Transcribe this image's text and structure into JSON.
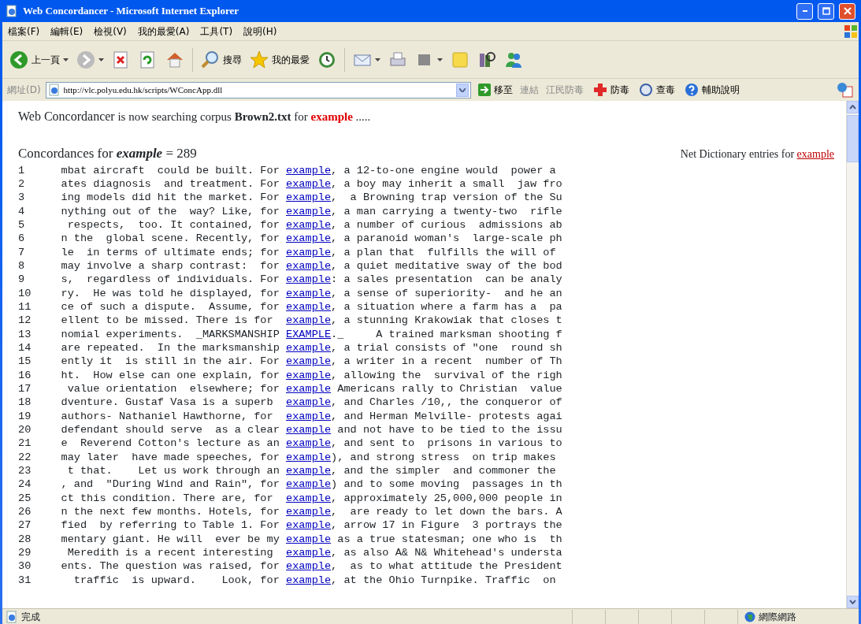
{
  "window": {
    "title": "Web Concordancer - Microsoft Internet Explorer"
  },
  "menu": [
    "檔案(F)",
    "編輯(E)",
    "檢視(V)",
    "我的最愛(A)",
    "工具(T)",
    "說明(H)"
  ],
  "toolbar": [
    {
      "kind": "back",
      "label": "上一頁"
    },
    {
      "kind": "forward"
    },
    {
      "kind": "stop"
    },
    {
      "kind": "refresh"
    },
    {
      "kind": "home"
    },
    {
      "kind": "search",
      "label": "搜尋"
    },
    {
      "kind": "favorites",
      "label": "我的最愛"
    },
    {
      "kind": "history"
    },
    {
      "kind": "mail"
    },
    {
      "kind": "print"
    },
    {
      "kind": "edit"
    },
    {
      "kind": "note"
    },
    {
      "kind": "research"
    },
    {
      "kind": "messenger"
    }
  ],
  "address": {
    "label": "網址(D)",
    "value": "http://vlc.polyu.edu.hk/scripts/WConcApp.dll",
    "go": "移至",
    "links_label": "連結",
    "links": [
      {
        "kind": "text",
        "label": "江民防毒"
      },
      {
        "kind": "cross",
        "label": "防毒"
      },
      {
        "kind": "scan",
        "label": "查毒"
      },
      {
        "kind": "help",
        "label": "輔助說明"
      }
    ]
  },
  "status_message": [
    {
      "kind": "brand",
      "text": "Web Concordancer"
    },
    {
      "kind": "plain",
      "text": " is now searching corpus "
    },
    {
      "kind": "bold",
      "text": "Brown2.txt"
    },
    {
      "kind": "plain",
      "text": " for "
    },
    {
      "kind": "keyword",
      "text": "example"
    },
    {
      "kind": "plain",
      "text": " ....."
    }
  ],
  "concordance_heading": [
    {
      "kind": "plain",
      "text": "Concordances for "
    },
    {
      "kind": "bolditalic",
      "text": "example"
    },
    {
      "kind": "plain",
      "text": " = 289"
    }
  ],
  "dictionary": {
    "text": "Net Dictionary entries for ",
    "link": "example"
  },
  "lines": [
    {
      "n": "1",
      "left": "mbat aircraft  could be built. For ",
      "key": "example",
      "right": ", a 12-to-one engine would  power a"
    },
    {
      "n": "2",
      "left": "ates diagnosis  and treatment. For ",
      "key": "example",
      "right": ", a boy may inherit a small  jaw fro"
    },
    {
      "n": "3",
      "left": "ing models did hit the market. For ",
      "key": "example",
      "right": ",  a Browning trap version of the Su"
    },
    {
      "n": "4",
      "left": "nything out of the  way? Like, for ",
      "key": "example",
      "right": ", a man carrying a twenty-two  rifle"
    },
    {
      "n": "5",
      "left": " respects,  too. It contained, for ",
      "key": "example",
      "right": ", a number of curious  admissions ab"
    },
    {
      "n": "6",
      "left": "n the  global scene. Recently, for ",
      "key": "example",
      "right": ", a paranoid woman's  large-scale ph"
    },
    {
      "n": "7",
      "left": "le  in terms of ultimate ends; for ",
      "key": "example",
      "right": ", a plan that  fulfills the will of"
    },
    {
      "n": "8",
      "left": "may involve a sharp contrast:  for ",
      "key": "example",
      "right": ", a quiet meditative sway of the bod"
    },
    {
      "n": "9",
      "left": "s,  regardless of individuals. For ",
      "key": "example",
      "right": ": a sales presentation  can be analy"
    },
    {
      "n": "10",
      "left": "ry.  He was told he displayed, for ",
      "key": "example",
      "right": ", a sense of superiority-  and he an"
    },
    {
      "n": "11",
      "left": "ce of such a dispute.  Assume, for ",
      "key": "example",
      "right": ", a situation where a farm has a  pa"
    },
    {
      "n": "12",
      "left": "ellent to be missed. There is for  ",
      "key": "example",
      "right": ", a stunning Krakowiak that closes t"
    },
    {
      "n": "13",
      "left": "nomial experiments.  _MARKSMANSHIP ",
      "key": "EXAMPLE",
      "right": "._     A trained marksman shooting f"
    },
    {
      "n": "14",
      "left": "are repeated.  In the marksmanship ",
      "key": "example",
      "right": ", a trial consists of \"one  round sh"
    },
    {
      "n": "15",
      "left": "ently it  is still in the air. For ",
      "key": "example",
      "right": ", a writer in a recent  number of Th"
    },
    {
      "n": "16",
      "left": "ht.  How else can one explain, for ",
      "key": "example",
      "right": ", allowing the  survival of the righ"
    },
    {
      "n": "17",
      "left": " value orientation  elsewhere; for ",
      "key": "example",
      "right": " Americans rally to Christian  value"
    },
    {
      "n": "18",
      "left": "dventure. Gustaf Vasa is a superb  ",
      "key": "example",
      "right": ", and Charles /10,, the conqueror of"
    },
    {
      "n": "19",
      "left": "authors- Nathaniel Hawthorne, for  ",
      "key": "example",
      "right": ", and Herman Melville- protests agai"
    },
    {
      "n": "20",
      "left": "defendant should serve  as a clear ",
      "key": "example",
      "right": " and not have to be tied to the issu"
    },
    {
      "n": "21",
      "left": "e  Reverend Cotton's lecture as an ",
      "key": "example",
      "right": ", and sent to  prisons in various to"
    },
    {
      "n": "22",
      "left": "may later  have made speeches, for ",
      "key": "example",
      "right": "), and strong stress  on trip makes"
    },
    {
      "n": "23",
      "left": "t that.    Let us work through an ",
      "key": "example",
      "right": ", and the simpler  and commoner the"
    },
    {
      "n": "24",
      "left": ", and  \"During Wind and Rain\", for ",
      "key": "example",
      "right": ") and to some moving  passages in th"
    },
    {
      "n": "25",
      "left": "ct this condition. There are, for  ",
      "key": "example",
      "right": ", approximately 25,000,000 people in"
    },
    {
      "n": "26",
      "left": "n the next few months. Hotels, for ",
      "key": "example",
      "right": ",  are ready to let down the bars. A"
    },
    {
      "n": "27",
      "left": "fied  by referring to Table 1. For ",
      "key": "example",
      "right": ", arrow 17 in Figure  3 portrays the"
    },
    {
      "n": "28",
      "left": "mentary giant. He will  ever be my ",
      "key": "example",
      "right": " as a true statesman; one who is  th"
    },
    {
      "n": "29",
      "left": " Meredith is a recent interesting  ",
      "key": "example",
      "right": ", as also A& N& Whitehead's understa"
    },
    {
      "n": "30",
      "left": "ents. The question was raised, for ",
      "key": "example",
      "right": ",  as to what attitude the President"
    },
    {
      "n": "31",
      "left": " traffic  is upward.    Look, for ",
      "key": "example",
      "right": ", at the Ohio Turnpike. Traffic  on"
    }
  ],
  "status_bar": {
    "text": "完成",
    "zone": "網際網路"
  }
}
